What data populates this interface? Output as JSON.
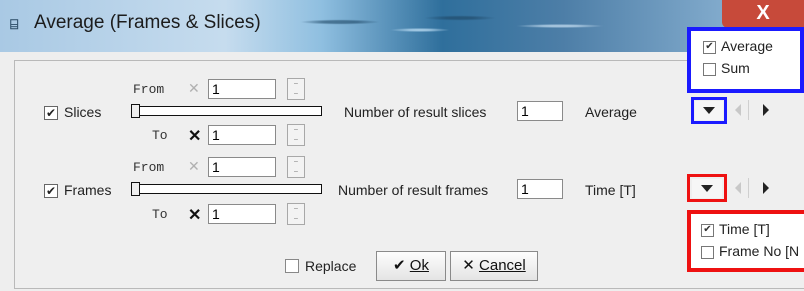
{
  "window": {
    "title": "Average (Frames & Slices)",
    "title_icon": "calc-icon",
    "close_glyph": "X"
  },
  "slices": {
    "checkbox_label": "Slices",
    "checked": true,
    "from_label": "From",
    "from_value": "1",
    "to_label": "To",
    "to_value": "1",
    "result_label": "Number of result slices",
    "result_value": "1",
    "mode_value": "Average"
  },
  "frames": {
    "checkbox_label": "Frames",
    "checked": true,
    "from_label": "From",
    "from_value": "1",
    "to_label": "To",
    "to_value": "1",
    "result_label": "Number of result frames",
    "result_value": "1",
    "mode_value": "Time [T]"
  },
  "x_glyph": "✕",
  "x_dark_glyph": "✕",
  "check_glyph": "✔",
  "replace": {
    "label": "Replace",
    "checked": false
  },
  "buttons": {
    "ok": "Ok",
    "cancel": "Cancel",
    "ok_icon": "✔",
    "cancel_icon": "✕"
  },
  "slices_menu": {
    "items": [
      {
        "label": "Average",
        "checked": true
      },
      {
        "label": "Sum",
        "checked": false
      }
    ]
  },
  "frames_menu": {
    "items": [
      {
        "label": "Time [T]",
        "checked": true
      },
      {
        "label": "Frame No [N",
        "checked": false
      }
    ]
  },
  "highlight_colors": {
    "slices": "#1a1aff",
    "frames": "#ee1111"
  },
  "menu_check_glyph": "✔"
}
